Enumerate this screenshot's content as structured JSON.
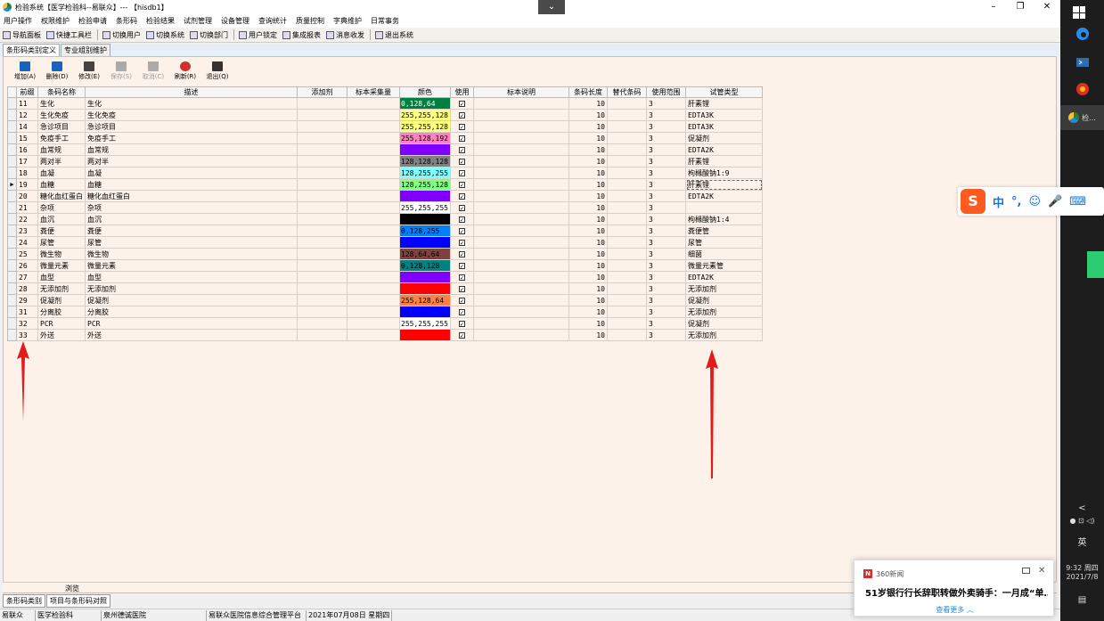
{
  "window": {
    "title": "检验系统【医学检验科--易联众】--- 【hisdb1】",
    "dropdown_glyph": "⌄",
    "min_glyph": "–",
    "max_glyph": "❐",
    "close_glyph": "✕"
  },
  "menu": [
    "用户操作",
    "权限维护",
    "检验申请",
    "条形码",
    "检验结果",
    "试剂管理",
    "设备管理",
    "查询统计",
    "质量控制",
    "字典维护",
    "日常事务"
  ],
  "toolbar": [
    "导航面板",
    "快捷工具栏",
    "切换用户",
    "切换系统",
    "切换部门",
    "用户锁定",
    "集成报表",
    "消息收发",
    "退出系统"
  ],
  "tabs": [
    "条形码类别定义",
    "专业组别维护"
  ],
  "actions": [
    {
      "label": "增加(A)",
      "icon": "add-icon",
      "enabled": true
    },
    {
      "label": "删除(D)",
      "icon": "delete-icon",
      "enabled": true
    },
    {
      "label": "修改(E)",
      "icon": "edit-icon",
      "enabled": true
    },
    {
      "label": "保存(S)",
      "icon": "save-icon",
      "enabled": false
    },
    {
      "label": "取消(C)",
      "icon": "cancel-icon",
      "enabled": false
    },
    {
      "label": "刷新(R)",
      "icon": "refresh-icon",
      "enabled": true
    },
    {
      "label": "退出(Q)",
      "icon": "exit-icon",
      "enabled": true
    }
  ],
  "grid": {
    "columns": [
      "前缀",
      "条码名称",
      "描述",
      "添加剂",
      "标本采集量",
      "颜色",
      "使用",
      "标本说明",
      "条码长度",
      "替代条码",
      "使用范围",
      "试管类型"
    ],
    "current_row": 7,
    "rows": [
      {
        "prefix": "11",
        "name": "生化",
        "desc": "生化",
        "color": "0,128,64",
        "bg": "#008040",
        "fg": "#ffffff",
        "len": "10",
        "range": "3",
        "tube": "肝素锂"
      },
      {
        "prefix": "12",
        "name": "生化免疫",
        "desc": "生化免疫",
        "color": "255,255,128",
        "bg": "#ffff80",
        "fg": "#000000",
        "len": "10",
        "range": "3",
        "tube": "EDTA3K"
      },
      {
        "prefix": "14",
        "name": "急诊项目",
        "desc": "急诊项目",
        "color": "255,255,128",
        "bg": "#ffff80",
        "fg": "#000000",
        "len": "10",
        "range": "3",
        "tube": "EDTA3K"
      },
      {
        "prefix": "15",
        "name": "免疫手工",
        "desc": "免疫手工",
        "color": "255,128,192",
        "bg": "#ff80c0",
        "fg": "#000000",
        "len": "10",
        "range": "3",
        "tube": "促凝剂"
      },
      {
        "prefix": "16",
        "name": "血常规",
        "desc": "血常规",
        "color": "128,0,255",
        "bg": "#8000ff",
        "fg": "#8000ff",
        "len": "10",
        "range": "3",
        "tube": "EDTA2K"
      },
      {
        "prefix": "17",
        "name": "两对半",
        "desc": "两对半",
        "color": "128,128,128",
        "bg": "#808080",
        "fg": "#000000",
        "len": "10",
        "range": "3",
        "tube": "肝素锂"
      },
      {
        "prefix": "18",
        "name": "血凝",
        "desc": "血凝",
        "color": "128,255,255",
        "bg": "#80ffff",
        "fg": "#000000",
        "len": "10",
        "range": "3",
        "tube": "枸橼酸钠1:9"
      },
      {
        "prefix": "19",
        "name": "血糖",
        "desc": "血糖",
        "color": "128,255,128",
        "bg": "#80ff80",
        "fg": "#000000",
        "len": "10",
        "range": "3",
        "tube": "肝素锂"
      },
      {
        "prefix": "20",
        "name": "糖化血红蛋白",
        "desc": "糖化血红蛋白",
        "color": "128,0,255",
        "bg": "#8000ff",
        "fg": "#8000ff",
        "len": "10",
        "range": "3",
        "tube": "EDTA2K"
      },
      {
        "prefix": "21",
        "name": "杂项",
        "desc": "杂项",
        "color": "255,255,255",
        "bg": "#ffffff",
        "fg": "#000000",
        "len": "10",
        "range": "3",
        "tube": ""
      },
      {
        "prefix": "22",
        "name": "血沉",
        "desc": "血沉",
        "color": "",
        "bg": "#000000",
        "fg": "#000000",
        "len": "10",
        "range": "3",
        "tube": "枸橼酸钠1:4"
      },
      {
        "prefix": "23",
        "name": "粪便",
        "desc": "粪便",
        "color": "0,128,255",
        "bg": "#0080ff",
        "fg": "#000000",
        "len": "10",
        "range": "3",
        "tube": "粪便管"
      },
      {
        "prefix": "24",
        "name": "尿管",
        "desc": "尿管",
        "color": "0,0,255",
        "bg": "#0000ff",
        "fg": "#0000ff",
        "len": "10",
        "range": "3",
        "tube": "尿管"
      },
      {
        "prefix": "25",
        "name": "微生物",
        "desc": "微生物",
        "color": "128,64,64",
        "bg": "#804040",
        "fg": "#000000",
        "len": "10",
        "range": "3",
        "tube": "细菌"
      },
      {
        "prefix": "26",
        "name": "微量元素",
        "desc": "微量元素",
        "color": "0,128,128",
        "bg": "#008080",
        "fg": "#000000",
        "len": "10",
        "range": "3",
        "tube": "微量元素管"
      },
      {
        "prefix": "27",
        "name": "血型",
        "desc": "血型",
        "color": "128,0,255",
        "bg": "#8000ff",
        "fg": "#8000ff",
        "len": "10",
        "range": "3",
        "tube": "EDTA2K"
      },
      {
        "prefix": "28",
        "name": "无添加剂",
        "desc": "无添加剂",
        "color": "255,0,0",
        "bg": "#ff0000",
        "fg": "#ff0000",
        "len": "10",
        "range": "3",
        "tube": "无添加剂"
      },
      {
        "prefix": "29",
        "name": "促凝剂",
        "desc": "促凝剂",
        "color": "255,128,64",
        "bg": "#ff8040",
        "fg": "#000000",
        "len": "10",
        "range": "3",
        "tube": "促凝剂"
      },
      {
        "prefix": "31",
        "name": "分离胶",
        "desc": "分离胶",
        "color": "0,0,255",
        "bg": "#0000ff",
        "fg": "#0000ff",
        "len": "10",
        "range": "3",
        "tube": "无添加剂"
      },
      {
        "prefix": "32",
        "name": "PCR",
        "desc": "PCR",
        "color": "255,255,255",
        "bg": "#ffffff",
        "fg": "#000000",
        "len": "10",
        "range": "3",
        "tube": "促凝剂"
      },
      {
        "prefix": "33",
        "name": "外送",
        "desc": "外送",
        "color": "255,0,0",
        "bg": "#ff0000",
        "fg": "#ff0000",
        "len": "10",
        "range": "3",
        "tube": "无添加剂"
      }
    ]
  },
  "filter_label": "浏览",
  "bottom_tabs": [
    "条形码类别",
    "项目与条形码对照"
  ],
  "status": [
    "易联众",
    "医学检验科",
    "泉州德诚医院",
    "易联众医院信息综合管理平台",
    "2021年07月08日 星期四"
  ],
  "notification": {
    "source": "360新闻",
    "logo": "N",
    "headline": "51岁银行行长辞职转做外卖骑手：一月成“单…",
    "more": "查看更多 ︿"
  },
  "ime": {
    "logo": "S",
    "items": [
      "中",
      "°,",
      "☺",
      "🎤",
      "⌨"
    ]
  },
  "taskbar": {
    "app_label": "检...",
    "time": "9:32 周四",
    "date": "2021/7/8",
    "lang": "英",
    "tray_glyph": "<"
  }
}
